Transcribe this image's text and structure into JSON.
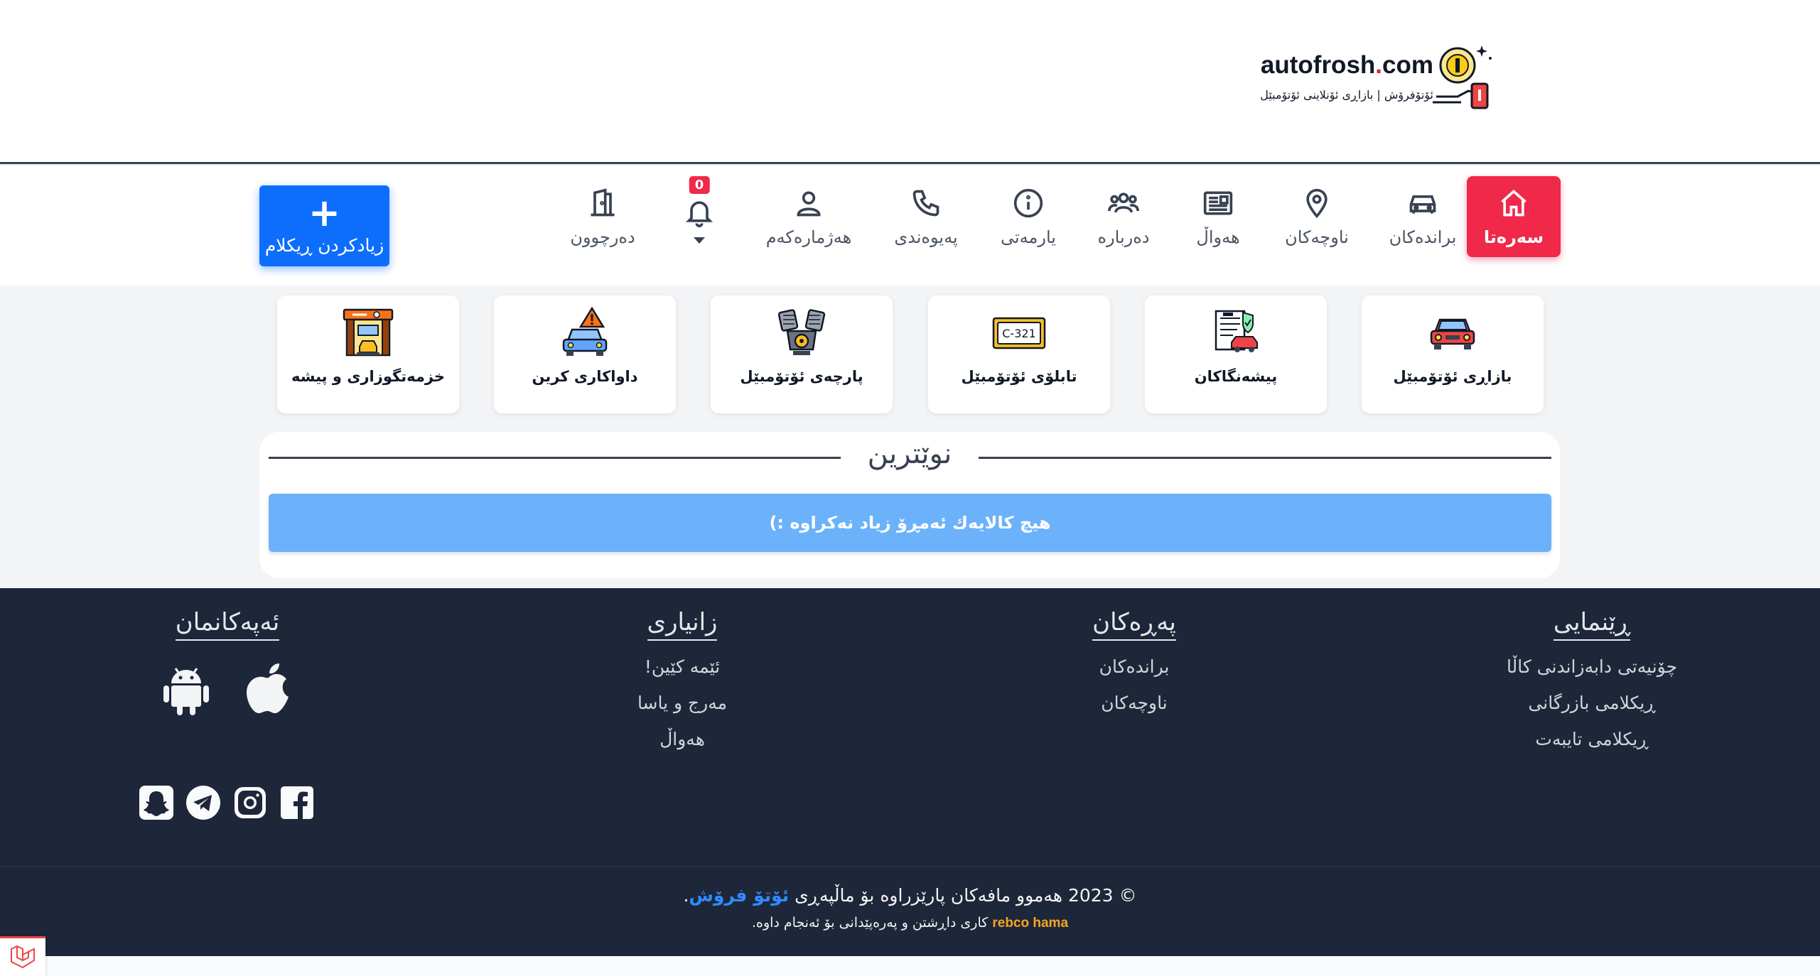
{
  "header": {
    "logo_text_main": "autofrosh",
    "logo_text_dot": ".",
    "logo_text_tld": "com",
    "logo_subtitle": "ئۆتۆفرۆش | بازاڕی ئۆنلاینی ئۆتۆمبێل"
  },
  "nav": {
    "home": "سەرەتا",
    "brands": "براندەکان",
    "regions": "ناوچەکان",
    "news": "هەواڵ",
    "about": "دەربارە",
    "help": "یارمەتی",
    "contact": "پەیوەندی",
    "account": "هەژمارەکەم",
    "notifications_count": "0",
    "logout": "دەرچوون",
    "add_ad_symbol": "+",
    "add_ad": "زیادکردن ڕیکلام"
  },
  "categories": [
    {
      "label": "بازاڕی ئۆتۆمبێل",
      "icon": "car-market-icon"
    },
    {
      "label": "پیشەنگاکان",
      "icon": "showroom-icon"
    },
    {
      "label": "تابلۆی ئۆتۆمبێل",
      "icon": "license-plate-icon",
      "plate_text": "C-321"
    },
    {
      "label": "پارچەی ئۆتۆمبێل",
      "icon": "engine-parts-icon"
    },
    {
      "label": "داواکاری کرین",
      "icon": "purchase-request-icon"
    },
    {
      "label": "خزمەتگوزاری و پیشە",
      "icon": "services-icon"
    }
  ],
  "latest": {
    "title": "نوێترین",
    "empty_message": "هیچ کالایەك ئەمڕۆ زیاد نەکراوە :)"
  },
  "footer": {
    "guide": {
      "heading": "ڕێنمایی",
      "links": [
        "چۆنیەتی دابەزاندنی کاڵا",
        "ڕیکلامی بازرگانی",
        "ڕیکلامی تایبەت"
      ]
    },
    "pages": {
      "heading": "پەڕەکان",
      "links": [
        "براندەکان",
        "ناوچەکان"
      ]
    },
    "info": {
      "heading": "زانیاری",
      "links": [
        "ئێمە کێین!",
        "مەرج و یاسا",
        "هەواڵ"
      ]
    },
    "apps": {
      "heading": "ئەپەکانمان",
      "items": [
        "apple-icon",
        "android-icon"
      ]
    },
    "socials": [
      "facebook-icon",
      "instagram-icon",
      "telegram-icon",
      "snapchat-icon"
    ],
    "copyright_prefix": "© 2023 هەموو مافەکان پارێزراوە بۆ ماڵپەڕی",
    "copyright_brand": "ئۆتۆ فرۆش",
    "copyright_suffix": ".",
    "credit_prefix": "کاری داڕشتن و پەرەپێدانی بۆ ئەنجام داوە.",
    "credit_dev": "rebco hama"
  },
  "colors": {
    "accent_red": "#f0284a",
    "primary_blue": "#0d6efd",
    "alert_blue": "#6cb2fa",
    "footer_bg": "#1e2639",
    "credit_orange": "#f5a524"
  }
}
